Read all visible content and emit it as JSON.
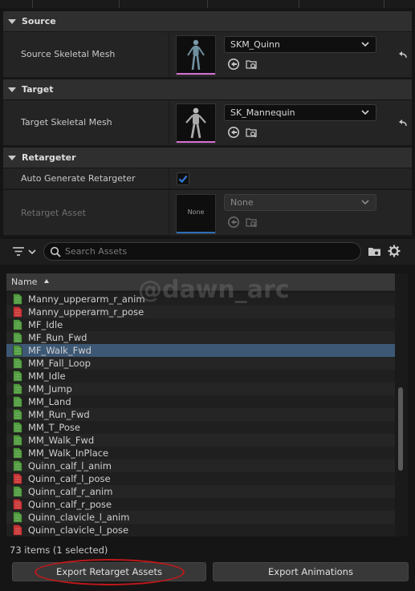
{
  "colors": {
    "panel_bg": "#151515",
    "category_header": "#2f2f2f",
    "row_bg": "#242424",
    "selected_row": "#3d5875",
    "asset_bar_skeletal": "#d46fd2",
    "asset_bar_none": "#2b6fb8",
    "checkbox_accent": "#2f7bd4",
    "anim_icon_green": "#4e9a3c",
    "pose_icon_red": "#c83232",
    "highlight_red": "#c0181a"
  },
  "sections": {
    "source": {
      "title": "Source",
      "property_label": "Source Skeletal Mesh",
      "selected_value": "SKM_Quinn",
      "thumbnail_icon": "quinn-mesh-thumbnail",
      "reset_icon": "reset-arrow-icon"
    },
    "target": {
      "title": "Target",
      "property_label": "Target Skeletal Mesh",
      "selected_value": "SK_Mannequin",
      "thumbnail_icon": "mannequin-mesh-thumbnail",
      "reset_icon": "reset-arrow-icon"
    },
    "retargeter": {
      "title": "Retargeter",
      "auto_generate_label": "Auto Generate Retargeter",
      "auto_generate_checked": true,
      "asset_label": "Retarget Asset",
      "asset_thumbnail_text": "None",
      "asset_value": "None"
    }
  },
  "search": {
    "placeholder": "Search Assets",
    "filter_icon": "filter-icon",
    "folder_icon": "folder-view-icon",
    "settings_icon": "gear-icon"
  },
  "asset_list": {
    "column_header": "Name",
    "sort_direction": "ascending",
    "rows": [
      {
        "name": "Manny_upperarm_r_anim",
        "kind": "anim",
        "selected": false
      },
      {
        "name": "Manny_upperarm_r_pose",
        "kind": "pose",
        "selected": false
      },
      {
        "name": "MF_Idle",
        "kind": "anim",
        "selected": false
      },
      {
        "name": "MF_Run_Fwd",
        "kind": "anim",
        "selected": false
      },
      {
        "name": "MF_Walk_Fwd",
        "kind": "anim",
        "selected": true
      },
      {
        "name": "MM_Fall_Loop",
        "kind": "anim",
        "selected": false
      },
      {
        "name": "MM_Idle",
        "kind": "anim",
        "selected": false
      },
      {
        "name": "MM_Jump",
        "kind": "anim",
        "selected": false
      },
      {
        "name": "MM_Land",
        "kind": "anim",
        "selected": false
      },
      {
        "name": "MM_Run_Fwd",
        "kind": "anim",
        "selected": false
      },
      {
        "name": "MM_T_Pose",
        "kind": "anim",
        "selected": false
      },
      {
        "name": "MM_Walk_Fwd",
        "kind": "anim",
        "selected": false
      },
      {
        "name": "MM_Walk_InPlace",
        "kind": "anim",
        "selected": false
      },
      {
        "name": "Quinn_calf_l_anim",
        "kind": "anim",
        "selected": false
      },
      {
        "name": "Quinn_calf_l_pose",
        "kind": "pose",
        "selected": false
      },
      {
        "name": "Quinn_calf_r_anim",
        "kind": "anim",
        "selected": false
      },
      {
        "name": "Quinn_calf_r_pose",
        "kind": "pose",
        "selected": false
      },
      {
        "name": "Quinn_clavicle_l_anim",
        "kind": "anim",
        "selected": false
      },
      {
        "name": "Quinn_clavicle_l_pose",
        "kind": "pose",
        "selected": false
      }
    ]
  },
  "watermark": "@dawn_arc",
  "status_text": "73 items (1 selected)",
  "buttons": {
    "export_retarget": "Export Retarget Assets",
    "export_animations": "Export Animations"
  }
}
